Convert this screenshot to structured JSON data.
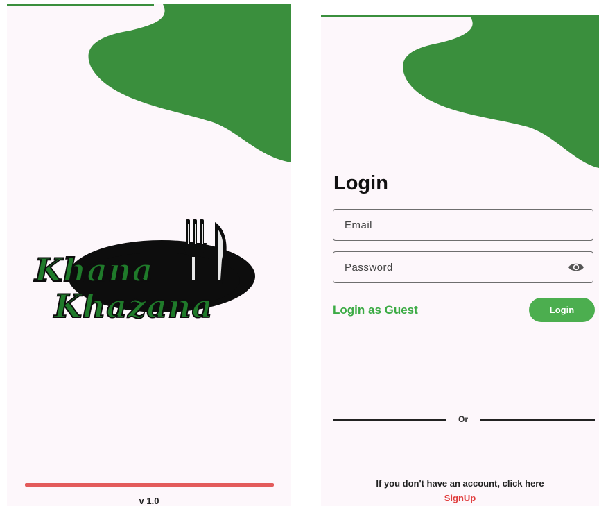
{
  "colors": {
    "accent_green": "#3a8f3d",
    "button_green": "#4cae4f",
    "link_green": "#3cab45",
    "progress_red": "#e35b5b",
    "signup_red": "#e03c3c",
    "background": "#fdf7fb"
  },
  "splash": {
    "logo": {
      "line1": "Khana",
      "line2": "Khazana",
      "icon": "fork-knife-icon"
    },
    "progress": 1.0,
    "version": "v 1.0"
  },
  "login": {
    "title": "Login",
    "email": {
      "placeholder": "Email",
      "value": ""
    },
    "password": {
      "placeholder": "Password",
      "value": "",
      "toggle_icon": "eye-icon"
    },
    "guest_label": "Login as Guest",
    "login_button": "Login",
    "divider_text": "Or",
    "signup_hint": "If you don't have an account, click here",
    "signup_label": "SignUp"
  }
}
